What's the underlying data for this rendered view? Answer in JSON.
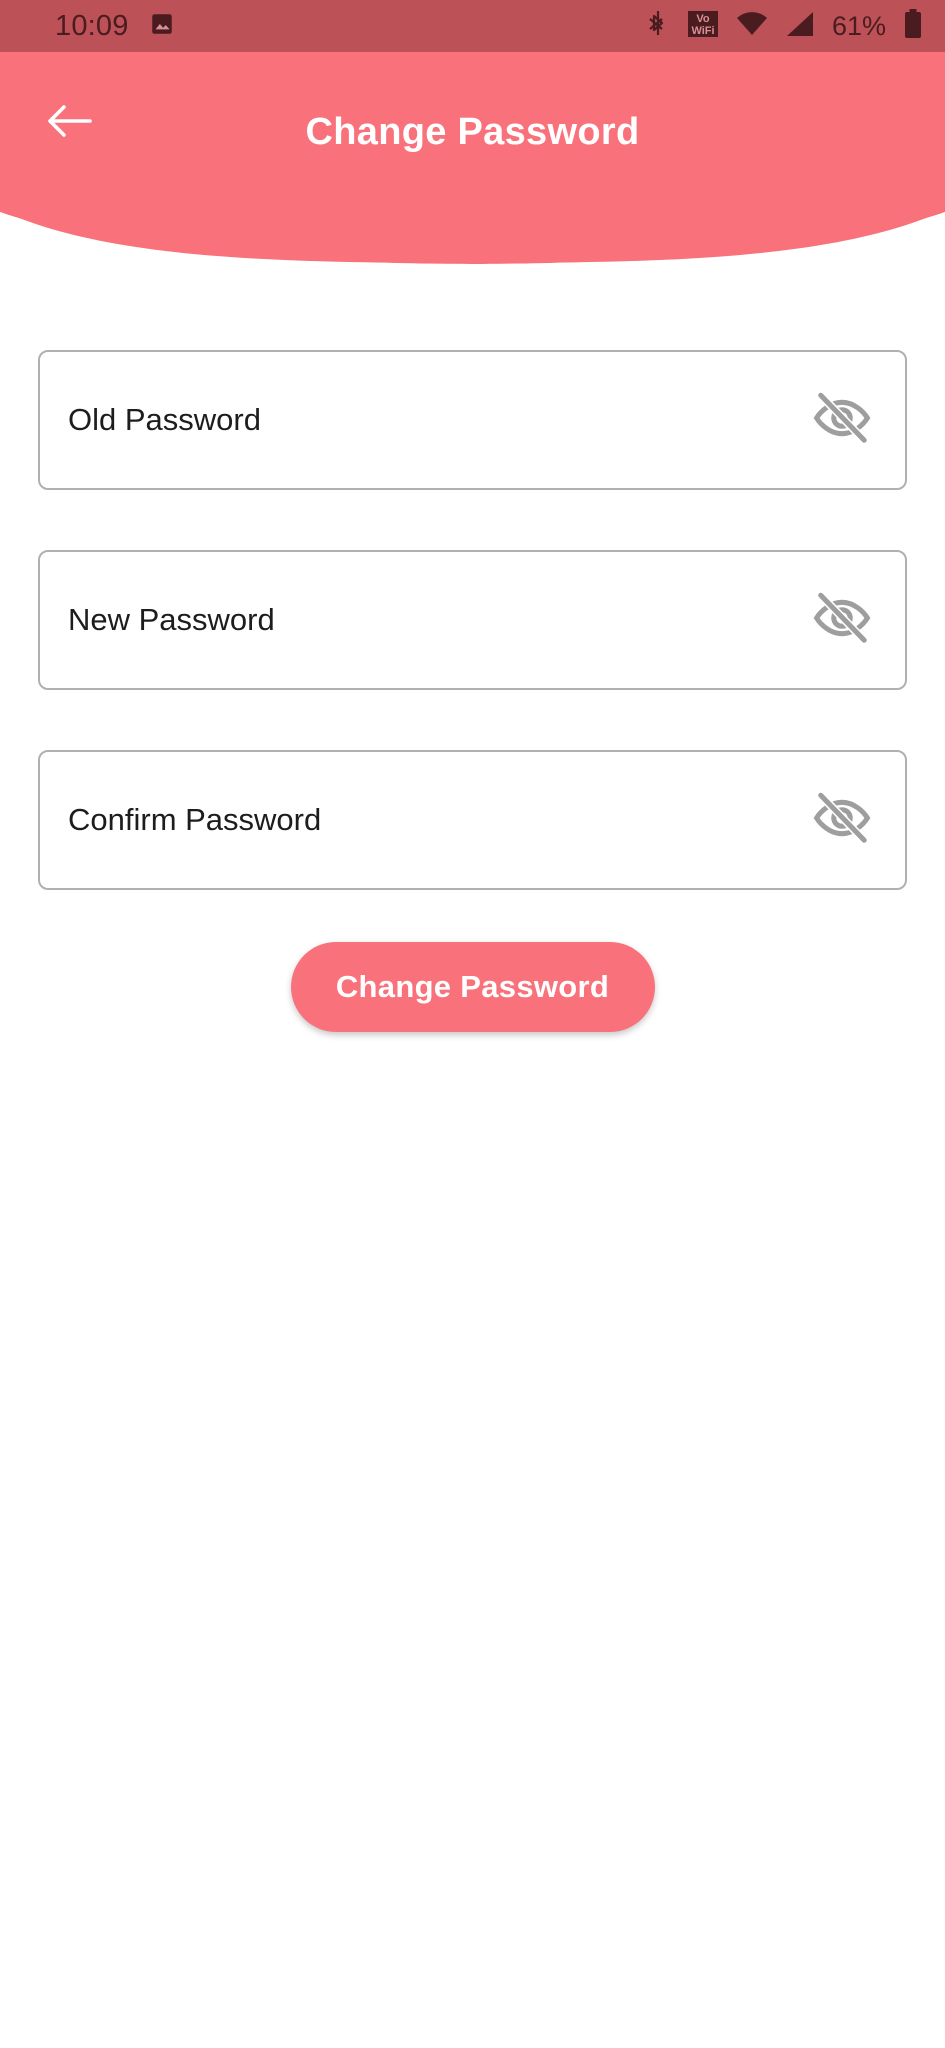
{
  "statusbar": {
    "time": "10:09",
    "battery_percent": "61%",
    "icons": [
      "photo-notification-icon",
      "bluetooth-icon",
      "vowifi-icon",
      "wifi-icon",
      "cellular-signal-icon",
      "battery-icon"
    ],
    "background_color": "#bc5157",
    "foreground_color": "#4a1c20"
  },
  "header": {
    "title": "Change Password",
    "back_icon": "arrow-left-icon",
    "background_color": "#f9717a",
    "title_color": "#ffffff"
  },
  "form": {
    "fields": [
      {
        "label": "Old Password",
        "value": "",
        "placeholder": "Old Password",
        "toggle_icon": "eye-off-icon",
        "masked": true
      },
      {
        "label": "New Password",
        "value": "",
        "placeholder": "New Password",
        "toggle_icon": "eye-off-icon",
        "masked": true
      },
      {
        "label": "Confirm Password",
        "value": "",
        "placeholder": "Confirm Password",
        "toggle_icon": "eye-off-icon",
        "masked": true
      }
    ],
    "submit_label": "Change Password",
    "submit_color": "#f9717a",
    "field_border_color": "#b0b0b0",
    "field_text_color": "#1d1d1d",
    "icon_color": "#9e9e9e"
  }
}
